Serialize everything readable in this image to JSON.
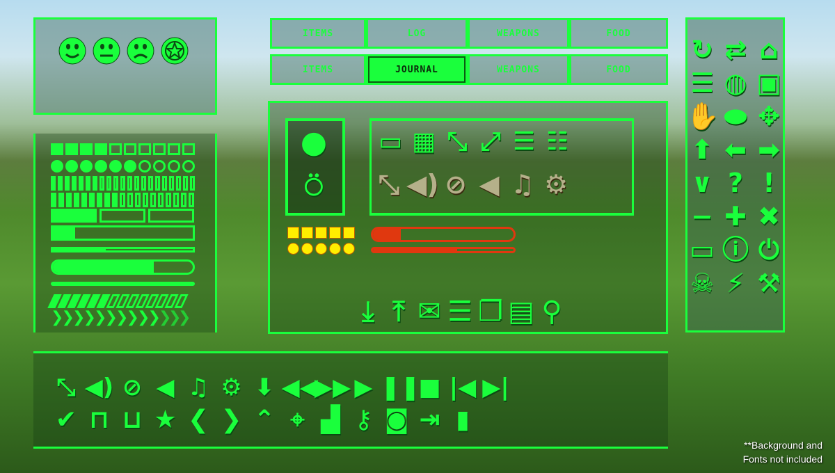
{
  "colors": {
    "accent": "#1aff3c",
    "yellow": "#ffee00",
    "red": "#e0380f",
    "tan": "#b5b08a"
  },
  "faces": [
    "happy-face-icon",
    "neutral-face-icon",
    "sad-face-icon",
    "star-badge-icon"
  ],
  "tabs_row1": [
    {
      "label": "ITEMS"
    },
    {
      "label": "LOG"
    },
    {
      "label": "WEAPONS"
    },
    {
      "label": "FOOD"
    }
  ],
  "tabs_row2": [
    {
      "label": "ITEMS"
    },
    {
      "label": "JOURNAL",
      "active": true
    },
    {
      "label": "WEAPONS"
    },
    {
      "label": "FOOD"
    }
  ],
  "meters": {
    "squares": {
      "filled": 4,
      "total": 10
    },
    "circles": {
      "filled": 6,
      "total": 10
    },
    "thin_bars": {
      "filled": 7,
      "total": 21
    },
    "capped_bars": {
      "filled": 9,
      "total": 19
    },
    "blocks": {
      "filled": 1,
      "total": 3
    },
    "progress_box": 0.16,
    "progress_thin": 0.38,
    "progress_pill": 0.72,
    "progress_line": 1.0,
    "slants": {
      "filled": 6,
      "total": 14
    },
    "chevrons": {
      "filled": 10,
      "total": 13
    }
  },
  "center": {
    "portrait_icons": [
      "user-icon",
      "medal-icon"
    ],
    "top_icons": [
      "chat-icon",
      "grid-icon",
      "shrink-icon",
      "expand-icon",
      "menu-icon",
      "list-icon"
    ],
    "tan_icons": [
      "resize-icon",
      "volume-icon",
      "ban-icon",
      "speaker-icon",
      "music-icon",
      "gear-icon"
    ],
    "yellow_squares": 5,
    "yellow_circles": 5,
    "health_bar": 0.2,
    "stamina_bar": 0.6,
    "bottom_icons": [
      "download-icon",
      "upload-icon",
      "mail-icon",
      "sliders-icon",
      "windows-icon",
      "window-icon",
      "search-icon"
    ]
  },
  "right_icons": [
    "refresh-icon",
    "sync-icon",
    "home-icon",
    "document-icon",
    "globe-icon",
    "shop-icon",
    "hand-icon",
    "circle-icon",
    "move-icon",
    "arrow-up-icon",
    "arrow-left-icon",
    "arrow-right-icon",
    "chevron-down-icon",
    "question-icon",
    "exclamation-icon",
    "minus-icon",
    "plus-icon",
    "close-icon",
    "battery-icon",
    "info-icon",
    "power-icon",
    "skull-icon",
    "lightning-icon",
    "wrench-icon"
  ],
  "bottom_row1": [
    "resize-icon",
    "volume-icon",
    "ban-icon",
    "speaker-icon",
    "music-icon",
    "gear-icon",
    "arrow-down-icon",
    "rewind-icon",
    "fast-forward-icon",
    "play-icon",
    "pause-icon",
    "stop-icon",
    "skip-back-icon",
    "skip-forward-icon"
  ],
  "bottom_row2": [
    "check-icon",
    "lock-icon",
    "unlock-icon",
    "star-icon",
    "chevron-left-icon",
    "chevron-right-icon",
    "chevron-up-icon",
    "crosshair-icon",
    "podium-icon",
    "key-icon",
    "camera-icon",
    "exit-icon",
    "bar-chart-icon"
  ],
  "note": {
    "line1": "**Background and",
    "line2": "Fonts not included"
  }
}
